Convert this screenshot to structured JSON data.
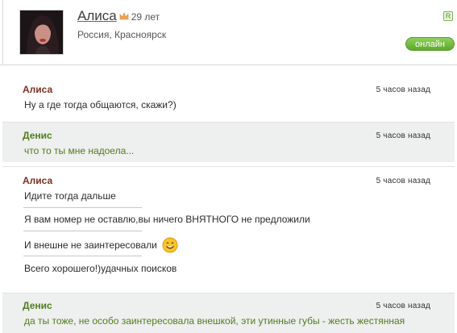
{
  "profile": {
    "name": "Алиса",
    "age": "29 лет",
    "location": "Россия, Красноярск",
    "status": "онлайн",
    "badge": "R"
  },
  "messages": [
    {
      "author": "Алиса",
      "time": "5 часов назад",
      "lines": [
        "Ну а где тогда общаются, скажи?)"
      ]
    },
    {
      "author": "Денис",
      "time": "5 часов назад",
      "lines": [
        "что то ты мне надоела..."
      ]
    },
    {
      "author": "Алиса",
      "time": "5 часов назад",
      "lines": [
        "Идите тогда дальше",
        "Я вам номер не оставлю,вы ничего ВНЯТНОГО не предложили",
        "И внешне не заинтересовали",
        "Всего хорошего!)удачных поисков"
      ]
    },
    {
      "author": "Денис",
      "time": "5 часов назад",
      "lines": [
        "да ты тоже, не особо заинтересовала внешкой, эти утинные губы - жесть жестянная"
      ]
    }
  ],
  "colors": {
    "alice_name": "#7a2e22",
    "denis_name": "#4f7d1d",
    "online_badge": "#6bb536",
    "gray_row": "#eeefef"
  },
  "icons": {
    "crown": "crown-icon",
    "smiley": "smiley-icon",
    "badge": "r-badge-icon"
  }
}
